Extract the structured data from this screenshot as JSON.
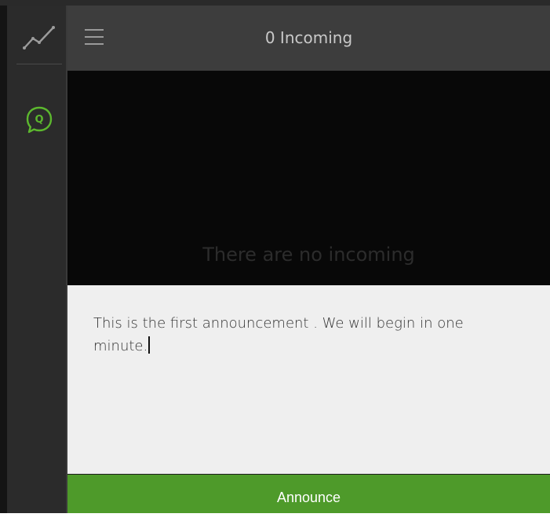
{
  "header": {
    "title": "0 Incoming"
  },
  "sidebar": {
    "items": [
      {
        "icon": "trend-line-icon"
      },
      {
        "icon": "q-chat-bubble-icon",
        "glyph": "Q"
      }
    ]
  },
  "incoming": {
    "empty_message": "There are no incoming"
  },
  "announcement": {
    "text": "This is the first announcement . We will begin in one minute."
  },
  "actions": {
    "announce_label": "Announce"
  },
  "colors": {
    "accent": "#4e9a2a",
    "header_bg": "#3d3d3d",
    "sidebar_bg": "#2b2b2b",
    "panel_bg": "#080808",
    "compose_bg": "#efefef"
  }
}
